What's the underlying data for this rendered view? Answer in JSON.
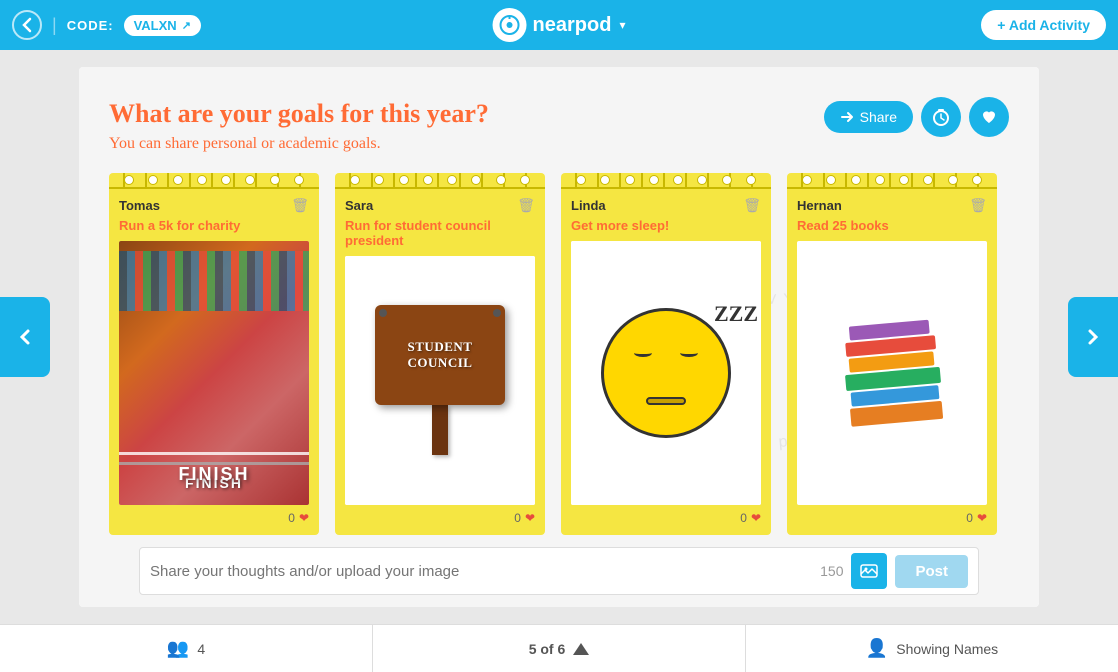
{
  "nav": {
    "back_label": "‹",
    "code_label": "CODE:",
    "code_value": "VALXN",
    "logo_text": "nearpod",
    "add_activity_label": "+ Add Activity"
  },
  "slide": {
    "title": "What are your goals for this year?",
    "subtitle": "You can share personal or academic goals.",
    "share_label": "Share",
    "cards": [
      {
        "name": "Tomas",
        "goal": "Run a 5k for charity",
        "image_type": "running",
        "likes": "0"
      },
      {
        "name": "Sara",
        "goal": "Run for student council president",
        "image_type": "sign",
        "likes": "0"
      },
      {
        "name": "Linda",
        "goal": "Get more sleep!",
        "image_type": "sleep",
        "likes": "0"
      },
      {
        "name": "Hernan",
        "goal": "Read 25 books",
        "image_type": "books",
        "likes": "0"
      }
    ],
    "sign_text": "STUDENT COUNCIL",
    "input_placeholder": "Share your thoughts and/or upload your image",
    "char_count": "150",
    "post_label": "Post"
  },
  "bottom": {
    "student_count": "4",
    "page_info": "5 of 6",
    "showing_label": "Showing Names"
  }
}
